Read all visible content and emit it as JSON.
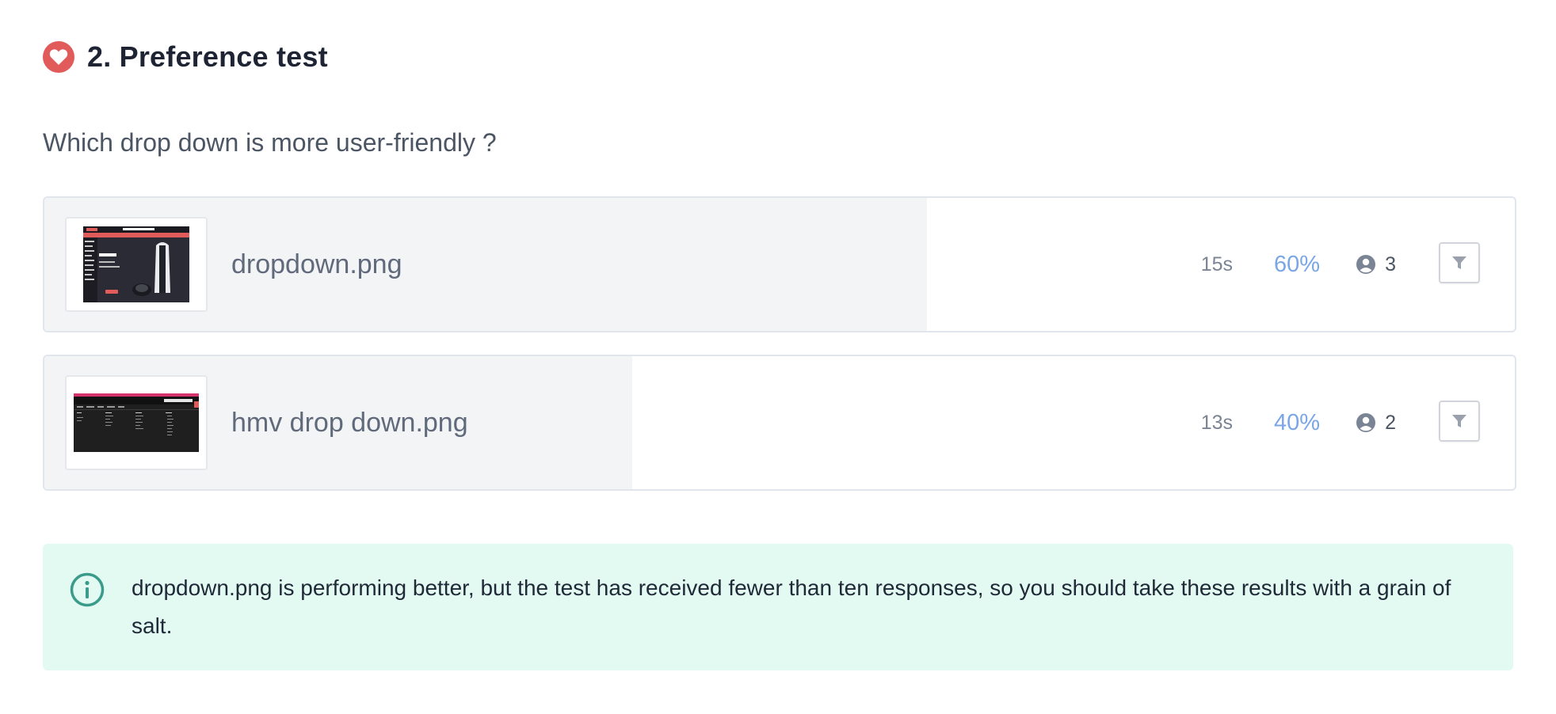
{
  "section": {
    "number_title": "2. Preference test",
    "icon": "heart-icon",
    "accent": "#e15b5b"
  },
  "question": "Which drop down is more user-friendly ?",
  "options": [
    {
      "name": "dropdown.png",
      "thumbnail": "dropdown-thumbnail",
      "time": "15s",
      "percent": "60%",
      "share": 0.6,
      "count": "3"
    },
    {
      "name": "hmv drop down.png",
      "thumbnail": "hmv-dropdown-thumbnail",
      "time": "13s",
      "percent": "40%",
      "share": 0.4,
      "count": "2"
    }
  ],
  "colors": {
    "fill": "#f3f4f6",
    "percent": "#7ba6e6",
    "notice_bg": "#e3faf2",
    "notice_icon": "#3a9b8a"
  },
  "notice": {
    "icon": "info-icon",
    "text": "dropdown.png is performing better, but the test has received fewer than ten responses, so you should take these results with a grain of salt."
  }
}
